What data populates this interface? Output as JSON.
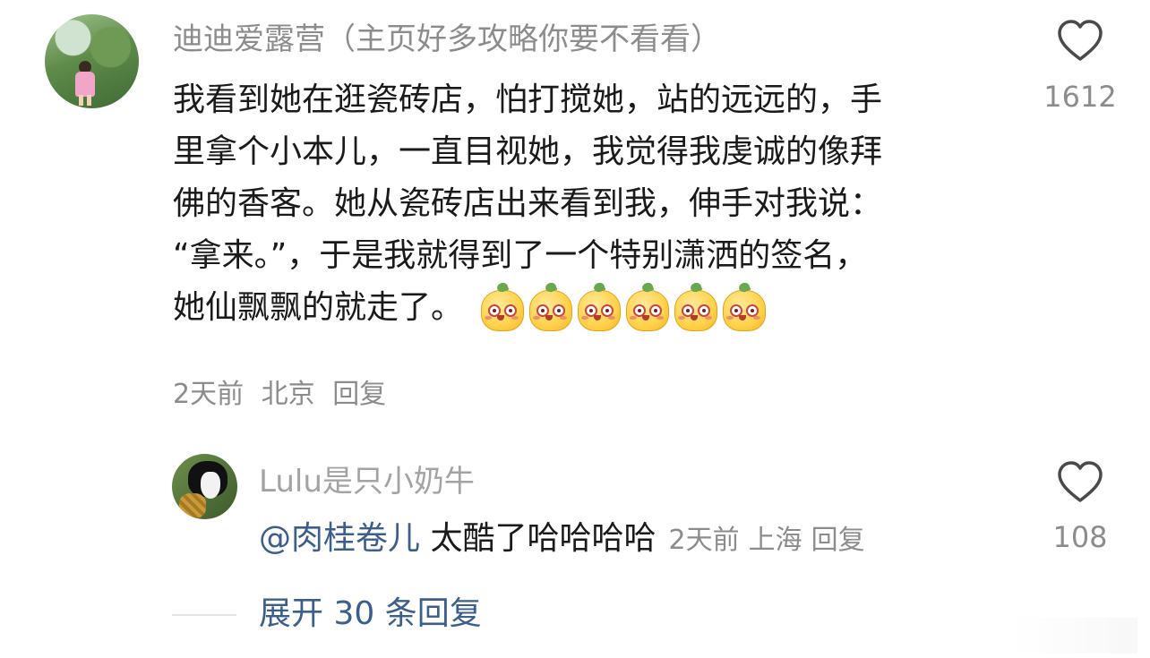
{
  "comment": {
    "username": "迪迪爱露营（主页好多攻略你要不看看）",
    "lines": [
      "我看到她在逛瓷砖店，怕打搅她，站的远远的，手",
      "里拿个小本儿，一直目视她，我觉得我虔诚的像拜",
      "佛的香客。她从瓷砖店出来看到我，伸手对我说：",
      "“拿来。”，于是我就得到了一个特别潇洒的签名，",
      "她仙飘飘的就走了。"
    ],
    "emoji_count": 6,
    "emoji_icon": "mango-emoji-icon",
    "time": "2天前",
    "location": "北京",
    "reply_label": "回复",
    "like_count": "1612"
  },
  "reply": {
    "username": "Lulu是只小奶牛",
    "mention": "@肉桂卷儿",
    "text": "太酷了哈哈哈哈",
    "time": "2天前",
    "location": "上海",
    "reply_label": "回复",
    "like_count": "108"
  },
  "expand_label": "展开 30 条回复",
  "colors": {
    "text": "#1a1a1a",
    "meta": "#8c8c8c",
    "link": "#3b5e8c"
  }
}
